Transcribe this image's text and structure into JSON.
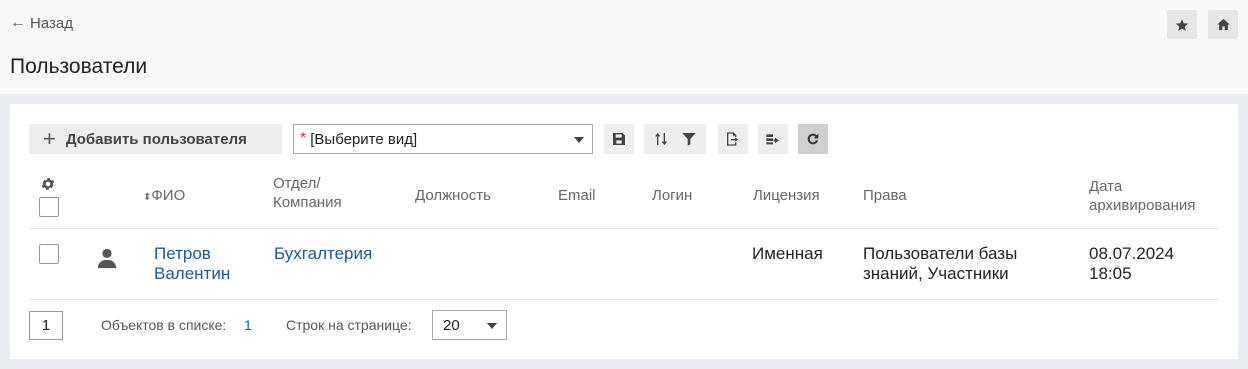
{
  "header": {
    "back_label": "Назад",
    "title": "Пользователи"
  },
  "toolbar": {
    "add_user_label": "Добавить пользователя",
    "view_select_value": "[Выберите вид]"
  },
  "table": {
    "columns": {
      "fio": "ФИО",
      "department_line1": "Отдел/",
      "department_line2": "Компания",
      "position": "Должность",
      "email": "Email",
      "login": "Логин",
      "license": "Лицензия",
      "rights": "Права",
      "archive_date_line1": "Дата",
      "archive_date_line2": "архивирования"
    },
    "rows": [
      {
        "fio_line1": "Петров",
        "fio_line2": "Валентин",
        "department": "Бухгалтерия",
        "position": "",
        "email": "",
        "login": "",
        "license": "Именная",
        "rights_line1": "Пользователи базы",
        "rights_line2": "знаний, Участники",
        "archive_date_line1": "08.07.2024",
        "archive_date_line2": "18:05"
      }
    ]
  },
  "footer": {
    "page": "1",
    "objects_label": "Объектов в списке:",
    "objects_count": "1",
    "rows_per_page_label": "Строк на странице:",
    "rows_per_page_value": "20"
  },
  "colors": {
    "link": "#1a5a96",
    "required_star": "#dd3333"
  }
}
